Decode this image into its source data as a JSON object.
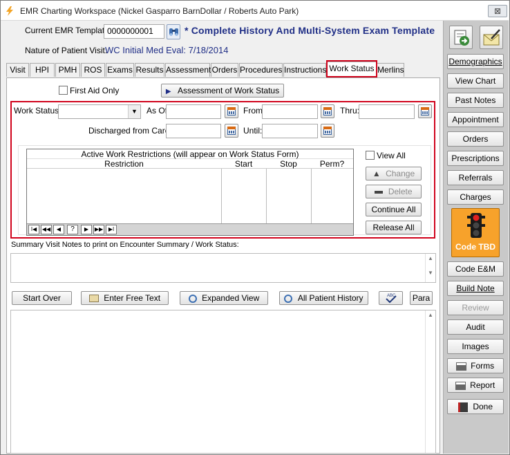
{
  "window": {
    "title": "EMR Charting Workspace (Nickel Gasparro BarnDollar / Roberts Auto Park)",
    "close": "⊠"
  },
  "header": {
    "template_label": "Current EMR Template:",
    "template_value": "0000000001",
    "template_name": "* Complete History And Multi-System Exam Template",
    "nature_label": "Nature of Patient Visit:",
    "nature_value": "WC  Initial Med Eval: 7/18/2014"
  },
  "tabs": [
    "Visit",
    "HPI",
    "PMH",
    "ROS",
    "Exams",
    "Results",
    "Assessment",
    "Orders",
    "Procedures",
    "Instructions",
    "Work Status",
    "Merlins"
  ],
  "active_tab": "Work Status",
  "first_aid_label": "First Aid Only",
  "first_aid_checked": false,
  "assessment_button": "Assessment of Work Status",
  "work_status": {
    "work_status_label": "Work Status:",
    "work_status_value": "",
    "as_of_label": "As Of",
    "from_label": "From:",
    "thru_label": "Thru:",
    "discharged_label": "Discharged from Care:",
    "until_label": "Until:"
  },
  "restrictions": {
    "caption": "Active Work Restrictions (will appear on Work Status Form)",
    "columns": [
      "Restriction",
      "Start",
      "Stop",
      "Perm?"
    ],
    "rows": [],
    "view_all": "View  All",
    "change": "Change",
    "delete": "Delete",
    "continue_all": "Continue All",
    "release_all": "Release All"
  },
  "summary_label": "Summary Visit Notes to print on Encounter Summary / Work Status:",
  "toolbar": {
    "start_over": "Start Over",
    "free_text": "Enter Free Text",
    "expanded": "Expanded View",
    "history": "All Patient History",
    "para": "Para"
  },
  "sidebar": {
    "demographics": "Demographics",
    "view_chart": "View Chart",
    "past_notes": "Past Notes",
    "appointment": "Appointment",
    "orders": "Orders",
    "prescriptions": "Prescriptions",
    "referrals": "Referrals",
    "charges": "Charges",
    "code_tbd": "Code TBD",
    "code_em": "Code E&M",
    "build_note": "Build Note",
    "review": "Review",
    "audit": "Audit",
    "images": "Images",
    "forms": "Forms",
    "report": "Report",
    "done": "Done"
  },
  "colors": {
    "highlight": "#d0021b",
    "navy": "#1f2e86",
    "code_tbd_bg": "#f7a22b",
    "sidebar_bg": "#c9c9c9"
  }
}
